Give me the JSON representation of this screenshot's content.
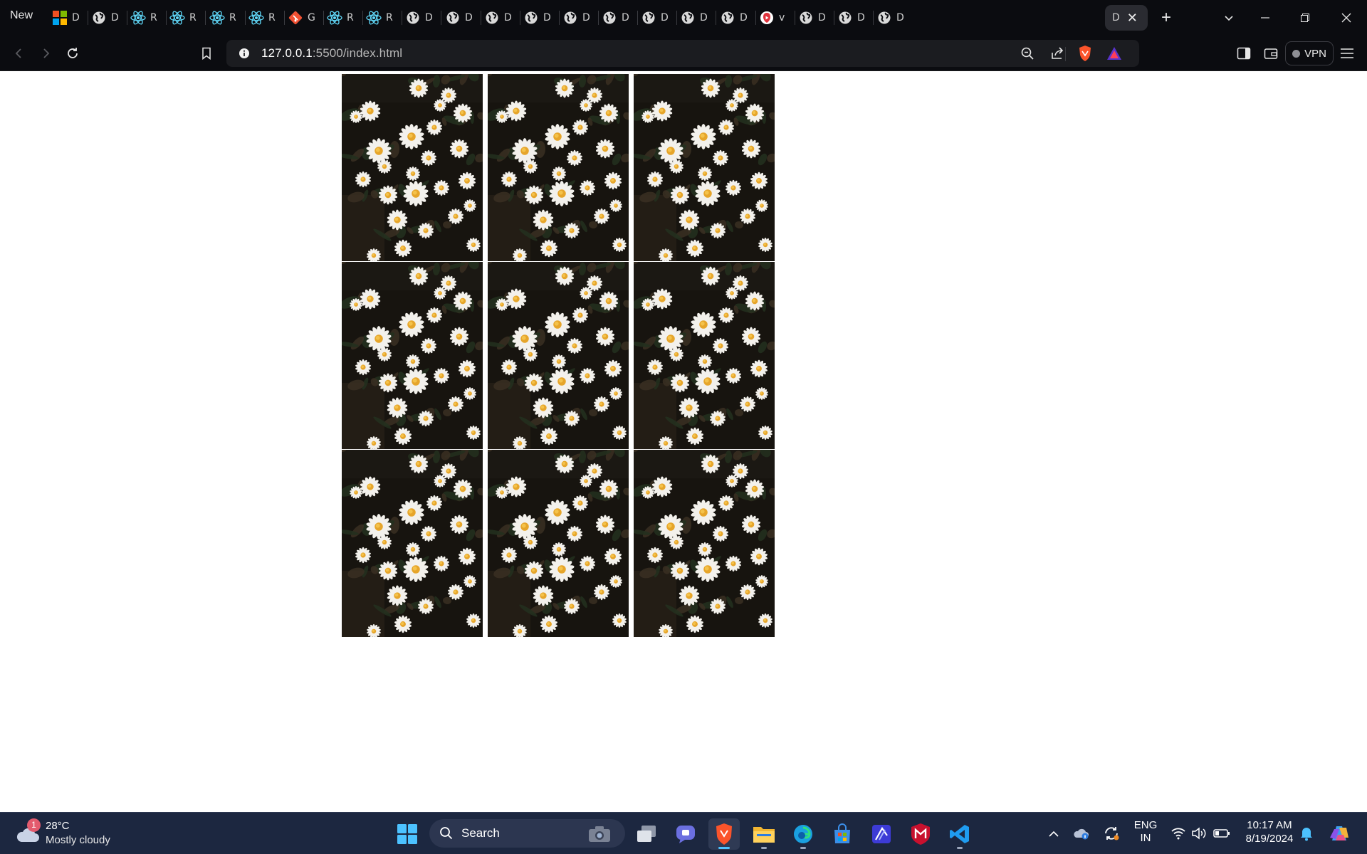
{
  "browser": {
    "new_tab_label": "New",
    "tabs": [
      {
        "icon": "microsoft-icon",
        "title": "D"
      },
      {
        "icon": "globe-icon",
        "title": "D"
      },
      {
        "icon": "react-icon",
        "title": "R"
      },
      {
        "icon": "react-icon",
        "title": "R"
      },
      {
        "icon": "react-icon",
        "title": "R"
      },
      {
        "icon": "react-icon",
        "title": "R"
      },
      {
        "icon": "git-icon",
        "title": "G"
      },
      {
        "icon": "react-icon",
        "title": "R"
      },
      {
        "icon": "react-icon",
        "title": "R"
      },
      {
        "icon": "globe-icon",
        "title": "D"
      },
      {
        "icon": "globe-icon",
        "title": "D"
      },
      {
        "icon": "globe-icon",
        "title": "D"
      },
      {
        "icon": "globe-icon",
        "title": "D"
      },
      {
        "icon": "globe-icon",
        "title": "D"
      },
      {
        "icon": "globe-icon",
        "title": "D"
      },
      {
        "icon": "globe-icon",
        "title": "D"
      },
      {
        "icon": "globe-icon",
        "title": "D"
      },
      {
        "icon": "globe-icon",
        "title": "D"
      },
      {
        "icon": "video-icon",
        "title": "v"
      },
      {
        "icon": "globe-icon",
        "title": "D"
      },
      {
        "icon": "globe-icon",
        "title": "D"
      },
      {
        "icon": "globe-icon",
        "title": "D"
      }
    ],
    "active_tab": {
      "title": "D",
      "close_glyph": "✕"
    },
    "new_tab_glyph": "+",
    "url": {
      "host": "127.0.0.1",
      "path": ":5500/index.html"
    },
    "vpn_label": "VPN"
  },
  "page": {
    "gallery": {
      "rows": 3,
      "columns": 3,
      "image_subject": "daisies on dark background",
      "count": 9
    }
  },
  "taskbar": {
    "weather": {
      "temp": "28°C",
      "desc": "Mostly cloudy",
      "badge": "1"
    },
    "search_label": "Search",
    "language": {
      "line1": "ENG",
      "line2": "IN"
    },
    "clock": {
      "time": "10:17 AM",
      "date": "8/19/2024"
    }
  },
  "colors": {
    "browser_chrome": "#0b0c10",
    "omnibox": "#1b1c20",
    "taskbar": "#1c2740",
    "brave_orange": "#fb542b",
    "react_cyan": "#61dafb"
  }
}
